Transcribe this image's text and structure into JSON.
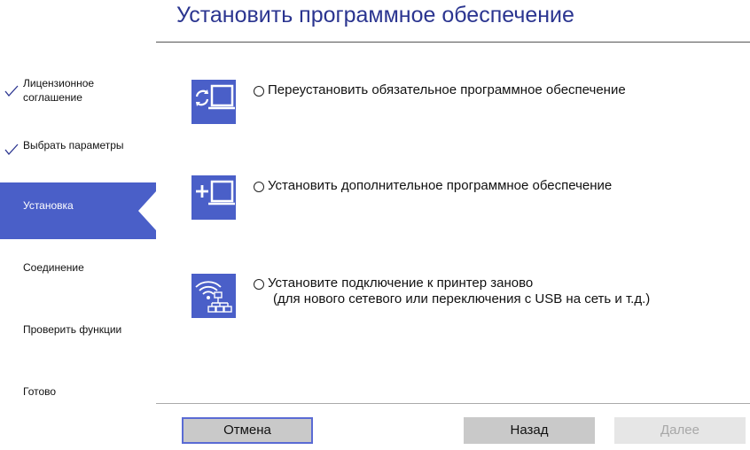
{
  "header": {
    "title": "Установить программное обеспечение"
  },
  "sidebar": {
    "steps": [
      {
        "label_lines": [
          "Лицензионное",
          "соглашение"
        ],
        "status": "done"
      },
      {
        "label_lines": [
          "Выбрать параметры"
        ],
        "status": "done"
      },
      {
        "label_lines": [
          "Установка"
        ],
        "status": "active"
      },
      {
        "label_lines": [
          "Соединение"
        ],
        "status": "pending"
      },
      {
        "label_lines": [
          "Проверить функции"
        ],
        "status": "pending"
      },
      {
        "label_lines": [
          "Готово"
        ],
        "status": "pending"
      }
    ]
  },
  "options": [
    {
      "icon": "reinstall-computer-icon",
      "lines": [
        "Переустановить обязательное программное обеспечение"
      ],
      "selected": false
    },
    {
      "icon": "add-software-computer-icon",
      "lines": [
        "Установить дополнительное программное обеспечение"
      ],
      "selected": false
    },
    {
      "icon": "wifi-network-icon",
      "lines": [
        "Установите подключение к принтер заново",
        "(для нового сетевого или переключения с USB на сеть и т.д.)"
      ],
      "selected": false
    }
  ],
  "buttons": {
    "cancel": "Отмена",
    "back": "Назад",
    "next": "Далее"
  },
  "colors": {
    "accent": "#4a5fc8",
    "title": "#2b3590",
    "button_gray": "#c9c9c9",
    "button_disabled": "#e6e6e6"
  }
}
